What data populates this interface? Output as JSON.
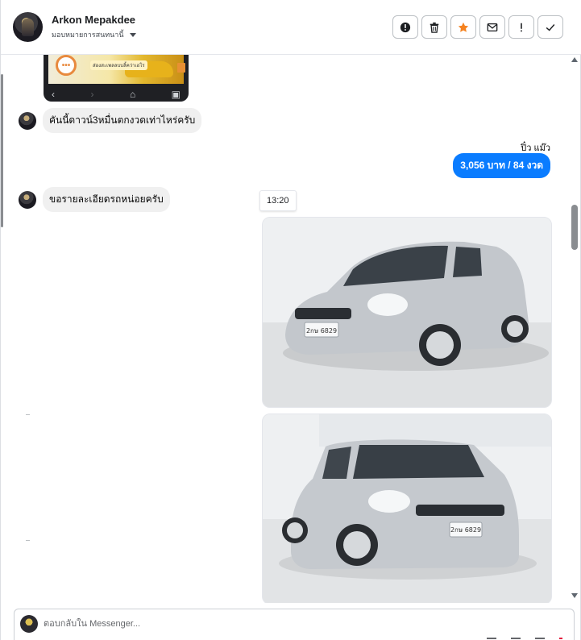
{
  "header": {
    "contact_name": "Arkon Mepakdee",
    "assign_label": "มอบหมายการสนทนานี้",
    "actions": [
      {
        "name": "report",
        "icon": "alert-circle-icon"
      },
      {
        "name": "delete",
        "icon": "trash-icon"
      },
      {
        "name": "star",
        "icon": "star-icon",
        "color": "#f5821f"
      },
      {
        "name": "mark-unread",
        "icon": "envelope-icon"
      },
      {
        "name": "spam",
        "icon": "exclamation-icon"
      },
      {
        "name": "done",
        "icon": "check-icon"
      }
    ]
  },
  "conversation": {
    "preview_promo_text": "ส่องสะเพลลบบลิ้คว่าเฮโร",
    "messages": [
      {
        "from": "contact",
        "text": "คันนี้ดาวน์3หมื่นตกงวดเท่าไหร่ครับ"
      },
      {
        "from": "page",
        "sender": "ปิ๋ว แม๊ว",
        "text": "3,056 บาท  / 84 งวด"
      },
      {
        "from": "contact",
        "text": "ขอรายละเอียดรถหน่อยครับ"
      }
    ],
    "timestamp": "13:20",
    "photos": [
      {
        "alt": "Silver Suzuki Swift hatchback, front three-quarter view",
        "plate": "2กษ 6829"
      },
      {
        "alt": "Silver Suzuki Swift hatchback, front view",
        "plate": "2กษ 6829"
      }
    ]
  },
  "composer": {
    "placeholder": "ตอบกลับใน Messenger..."
  },
  "colors": {
    "accent": "#0a7cff",
    "star": "#f5821f",
    "incoming_bubble": "#f0f0f0"
  }
}
